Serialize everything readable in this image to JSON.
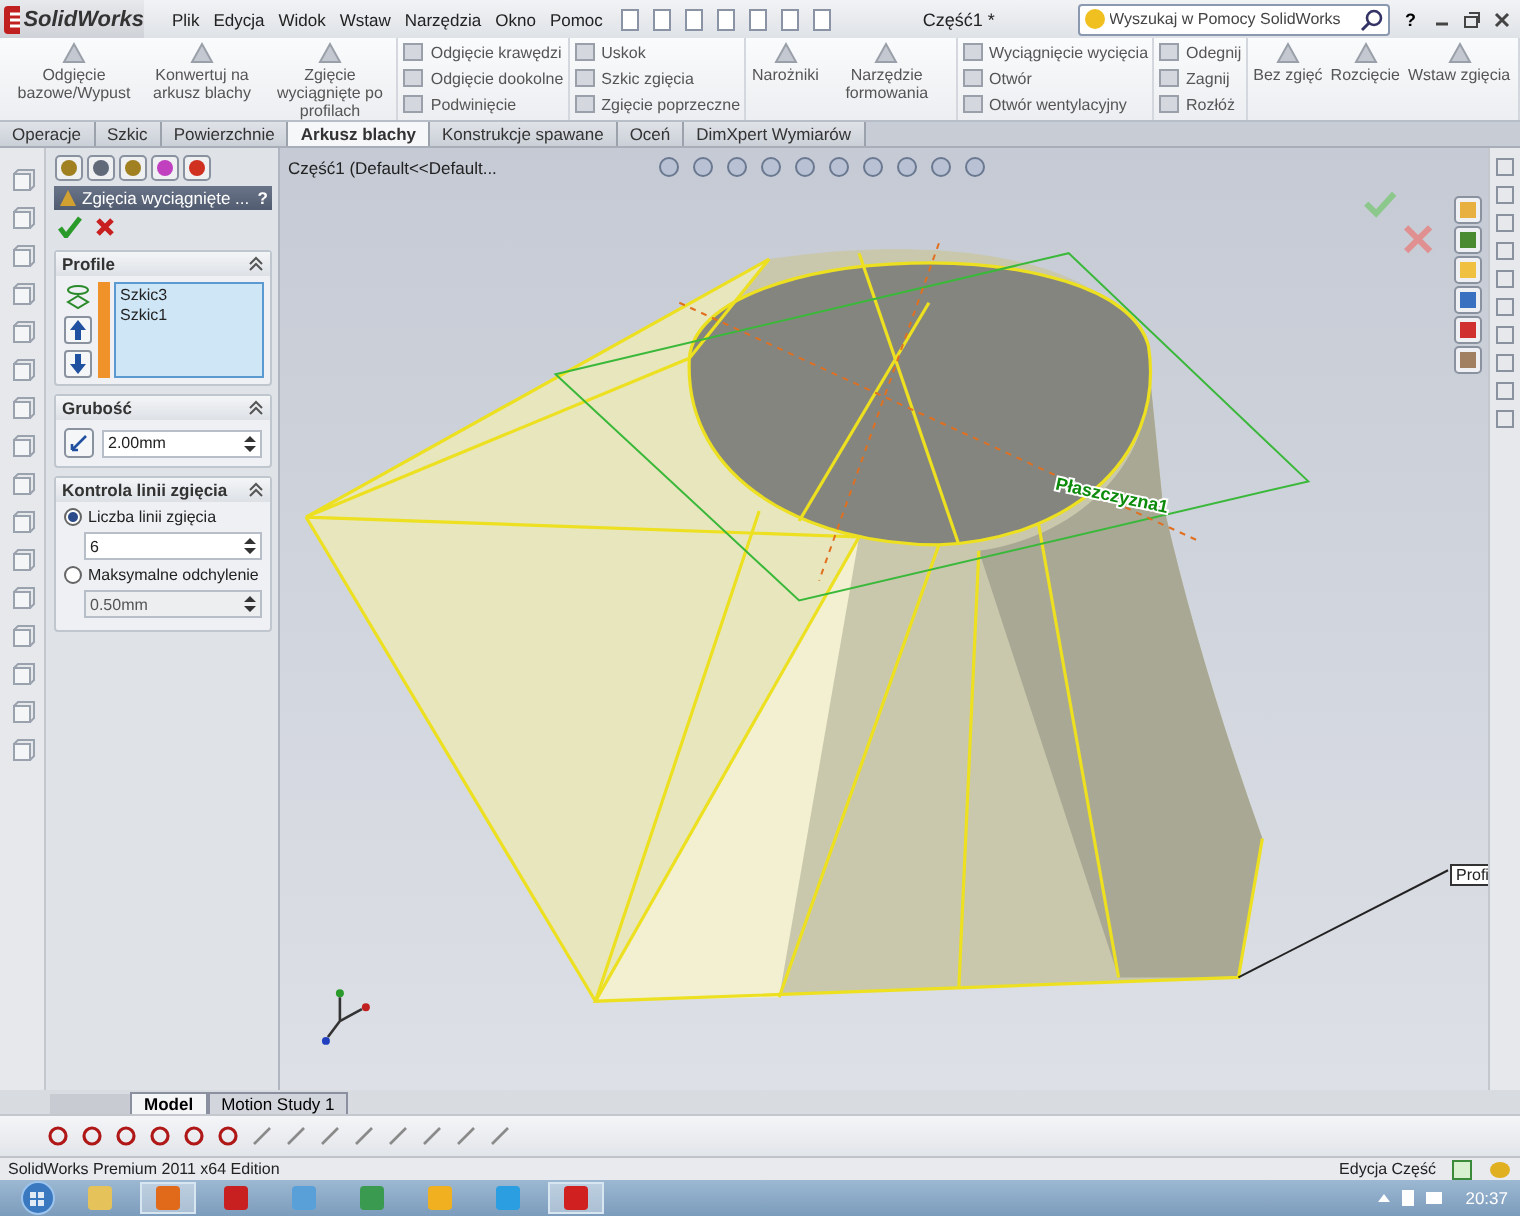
{
  "title_bar": {
    "app": "SolidWorks",
    "menus": [
      "Plik",
      "Edycja",
      "Widok",
      "Wstaw",
      "Narzędzia",
      "Okno",
      "Pomoc"
    ],
    "document_title": "Część1 *",
    "search": {
      "placeholder": "Wyszukaj w Pomocy SolidWorks"
    },
    "help": "?"
  },
  "ribbon": [
    {
      "kind": "large",
      "items": [
        "Odgięcie bazowe/Wypust",
        "Konwertuj na arkusz blachy",
        "Zgięcie wyciągnięte po profilach"
      ]
    },
    {
      "kind": "small",
      "items": [
        "Odgięcie krawędzi",
        "Odgięcie dookolne",
        "Podwinięcie"
      ]
    },
    {
      "kind": "small",
      "items": [
        "Uskok",
        "Szkic zgięcia",
        "Zgięcie poprzeczne"
      ]
    },
    {
      "kind": "large",
      "items": [
        "Narożniki",
        "Narzędzie formowania"
      ]
    },
    {
      "kind": "small",
      "items": [
        "Wyciągnięcie wycięcia",
        "Otwór",
        "Otwór wentylacyjny"
      ]
    },
    {
      "kind": "small",
      "items": [
        "Odegnij",
        "Zagnij",
        "Rozłóż"
      ]
    },
    {
      "kind": "large",
      "items": [
        "Bez zgięć",
        "Rozcięcie",
        "Wstaw zgięcia"
      ]
    }
  ],
  "tabs": [
    {
      "label": "Operacje",
      "selected": false
    },
    {
      "label": "Szkic",
      "selected": false
    },
    {
      "label": "Powierzchnie",
      "selected": false
    },
    {
      "label": "Arkusz blachy",
      "selected": true
    },
    {
      "label": "Konstrukcje spawane",
      "selected": false
    },
    {
      "label": "Oceń",
      "selected": false
    },
    {
      "label": "DimXpert Wymiarów",
      "selected": false
    }
  ],
  "feature_tree": {
    "label": "Część1  (Default<<Default..."
  },
  "property_manager": {
    "title": "Zgięcia wyciągnięte ...",
    "help": "?",
    "sections": [
      {
        "kind": "list",
        "title": "Profile",
        "items": [
          "Szkic3",
          "Szkic1"
        ]
      },
      {
        "kind": "spin",
        "title": "Grubość",
        "value": "2.00mm"
      },
      {
        "kind": "radios",
        "title": "Kontrola linii zgięcia",
        "options": [
          {
            "label": "Liczba linii zgięcia",
            "selected": true,
            "value": "6"
          },
          {
            "label": "Maksymalne odchylenie",
            "selected": false,
            "value": "0.50mm"
          }
        ]
      }
    ]
  },
  "viewport": {
    "plane_label": "Płaszczyzna1",
    "callout": "Profi"
  },
  "bottom_tabs": [
    {
      "label": "Model",
      "selected": true
    },
    {
      "label": "Motion Study 1",
      "selected": false
    }
  ],
  "status_bar": {
    "edition": "SolidWorks Premium 2011 x64 Edition",
    "mode": "Edycja Część"
  },
  "taskbar": {
    "time": "20:37"
  }
}
